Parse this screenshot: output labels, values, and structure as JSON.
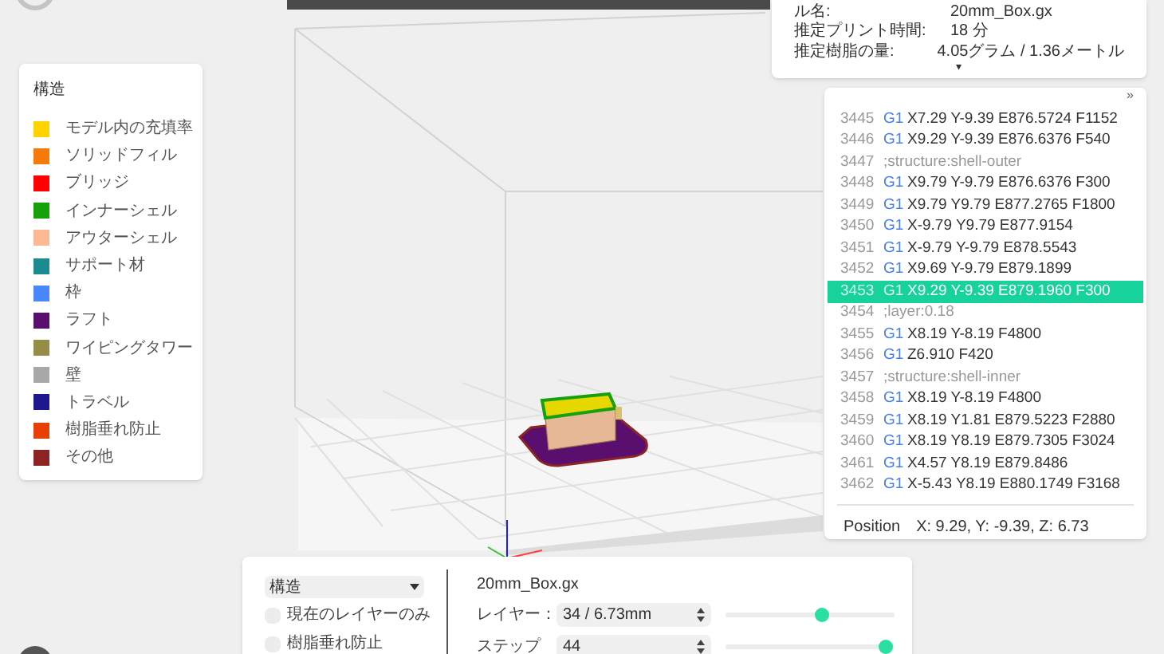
{
  "legend": {
    "title": "構造",
    "items": [
      {
        "label": "モデル内の充填率",
        "color": "#ffd200"
      },
      {
        "label": "ソリッドフィル",
        "color": "#f57a0a"
      },
      {
        "label": "ブリッジ",
        "color": "#ff0000"
      },
      {
        "label": "インナーシェル",
        "color": "#16a00a"
      },
      {
        "label": "アウターシェル",
        "color": "#fdb994"
      },
      {
        "label": "サポート材",
        "color": "#1b8b8f"
      },
      {
        "label": "枠",
        "color": "#4a87ff"
      },
      {
        "label": "ラフト",
        "color": "#5a0f6e"
      },
      {
        "label": "ワイピングタワー",
        "color": "#958c48"
      },
      {
        "label": "壁",
        "color": "#a8a8a8"
      },
      {
        "label": "トラベル",
        "color": "#1e1790"
      },
      {
        "label": "樹脂垂れ防止",
        "color": "#e83f06"
      },
      {
        "label": "その他",
        "color": "#8c2424"
      }
    ]
  },
  "info": {
    "rows": [
      {
        "label": "ル名:",
        "value": "20mm_Box.gx"
      },
      {
        "label": "推定プリント時間:",
        "value": "18 分"
      },
      {
        "label": "推定樹脂の量:",
        "value": "4.05グラム / 1.36メートル"
      }
    ],
    "expand": "▾"
  },
  "gcode": {
    "collapse": "»",
    "lines": [
      {
        "number": "3445",
        "kind": "command",
        "code": "G1",
        "text": "X7.29 Y-9.39 E876.5724 F1152",
        "selected": false
      },
      {
        "number": "3446",
        "kind": "command",
        "code": "G1",
        "text": "X9.29 Y-9.39 E876.6376 F540",
        "selected": false
      },
      {
        "number": "3447",
        "kind": "comment",
        "text": ";structure:shell-outer",
        "selected": false
      },
      {
        "number": "3448",
        "kind": "command",
        "code": "G1",
        "text": "X9.79 Y-9.79 E876.6376 F300",
        "selected": false
      },
      {
        "number": "3449",
        "kind": "command",
        "code": "G1",
        "text": "X9.79 Y9.79 E877.2765 F1800",
        "selected": false
      },
      {
        "number": "3450",
        "kind": "command",
        "code": "G1",
        "text": "X-9.79 Y9.79 E877.9154",
        "selected": false
      },
      {
        "number": "3451",
        "kind": "command",
        "code": "G1",
        "text": "X-9.79 Y-9.79 E878.5543",
        "selected": false
      },
      {
        "number": "3452",
        "kind": "command",
        "code": "G1",
        "text": "X9.69 Y-9.79 E879.1899",
        "selected": false
      },
      {
        "number": "3453",
        "kind": "command",
        "code": "G1",
        "text": "X9.29 Y-9.39 E879.1960 F300",
        "selected": true
      },
      {
        "number": "3454",
        "kind": "comment",
        "text": ";layer:0.18",
        "selected": false
      },
      {
        "number": "3455",
        "kind": "command",
        "code": "G1",
        "text": "X8.19 Y-8.19 F4800",
        "selected": false
      },
      {
        "number": "3456",
        "kind": "command",
        "code": "G1",
        "text": "Z6.910 F420",
        "selected": false
      },
      {
        "number": "3457",
        "kind": "comment",
        "text": ";structure:shell-inner",
        "selected": false
      },
      {
        "number": "3458",
        "kind": "command",
        "code": "G1",
        "text": "X8.19 Y-8.19 F4800",
        "selected": false
      },
      {
        "number": "3459",
        "kind": "command",
        "code": "G1",
        "text": "X8.19 Y1.81 E879.5223 F2880",
        "selected": false
      },
      {
        "number": "3460",
        "kind": "command",
        "code": "G1",
        "text": "X8.19 Y8.19 E879.7305 F3024",
        "selected": false
      },
      {
        "number": "3461",
        "kind": "command",
        "code": "G1",
        "text": "X4.57 Y8.19 E879.8486",
        "selected": false
      },
      {
        "number": "3462",
        "kind": "command",
        "code": "G1",
        "text": "X-5.43 Y8.19 E880.1749 F3168",
        "selected": false
      }
    ],
    "position_label": "Position",
    "position_value": "X: 9.29, Y: -9.39, Z: 6.73"
  },
  "controls": {
    "view_select": "構造",
    "checkboxes": [
      {
        "label": "現在のレイヤーのみ",
        "checked": false
      },
      {
        "label": "樹脂垂れ防止",
        "checked": false
      }
    ],
    "file_name": "20mm_Box.gx",
    "rows": [
      {
        "label": "レイヤー：",
        "value": "34 / 6.73mm",
        "level": 0.57
      },
      {
        "label": "ステップ",
        "value": "44",
        "level": 0.95
      }
    ]
  }
}
